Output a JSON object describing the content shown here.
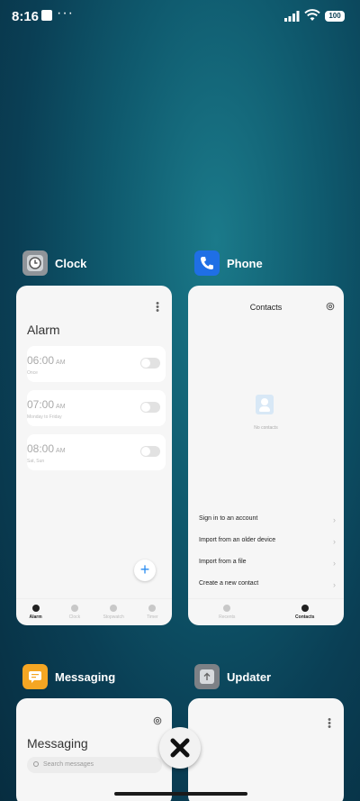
{
  "status": {
    "time": "8:16",
    "dots": "···",
    "battery": "100"
  },
  "clock": {
    "app_name": "Clock",
    "title": "Alarm",
    "alarms": [
      {
        "time": "06:00",
        "ampm": "AM",
        "sub": "Once"
      },
      {
        "time": "07:00",
        "ampm": "AM",
        "sub": "Monday to Friday"
      },
      {
        "time": "08:00",
        "ampm": "AM",
        "sub": "Sat, Sun"
      }
    ],
    "add_label": "+",
    "tabs": [
      "Alarm",
      "Clock",
      "Stopwatch",
      "Timer"
    ]
  },
  "phone": {
    "app_name": "Phone",
    "title": "Contacts",
    "empty_text": "No contacts",
    "options": [
      "Sign in to an account",
      "Import from an older device",
      "Import from a file",
      "Create a new contact"
    ],
    "tabs": [
      "Recents",
      "Contacts"
    ]
  },
  "messaging": {
    "app_name": "Messaging",
    "title": "Messaging",
    "search_placeholder": "Search messages"
  },
  "updater": {
    "app_name": "Updater"
  }
}
